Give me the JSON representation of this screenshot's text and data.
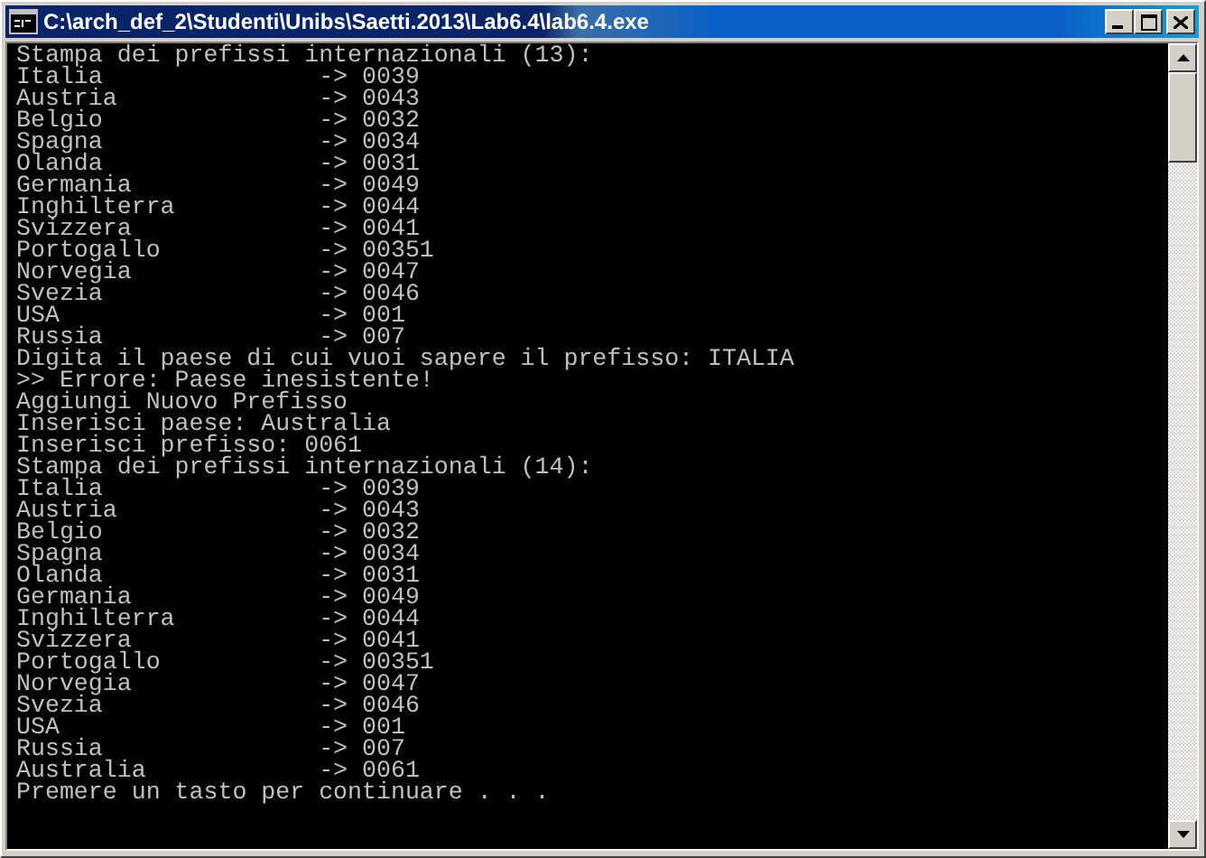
{
  "window": {
    "title": "C:\\arch_def_2\\Studenti\\Unibs\\Saetti.2013\\Lab6.4\\lab6.4.exe"
  },
  "console": {
    "lines": [
      "Stampa dei prefissi internazionali (13):",
      "Italia               -> 0039",
      "Austria              -> 0043",
      "Belgio               -> 0032",
      "Spagna               -> 0034",
      "Olanda               -> 0031",
      "Germania             -> 0049",
      "Inghilterra          -> 0044",
      "Svizzera             -> 0041",
      "Portogallo           -> 00351",
      "Norvegia             -> 0047",
      "Svezia               -> 0046",
      "USA                  -> 001",
      "Russia               -> 007",
      "Digita il paese di cui vuoi sapere il prefisso: ITALIA",
      ">> Errore: Paese inesistente!",
      "Aggiungi Nuovo Prefisso",
      "Inserisci paese: Australia",
      "Inserisci prefisso: 0061",
      "Stampa dei prefissi internazionali (14):",
      "Italia               -> 0039",
      "Austria              -> 0043",
      "Belgio               -> 0032",
      "Spagna               -> 0034",
      "Olanda               -> 0031",
      "Germania             -> 0049",
      "Inghilterra          -> 0044",
      "Svizzera             -> 0041",
      "Portogallo           -> 00351",
      "Norvegia             -> 0047",
      "Svezia               -> 0046",
      "USA                  -> 001",
      "Russia               -> 007",
      "Australia            -> 0061",
      "Premere un tasto per continuare . . ."
    ]
  }
}
